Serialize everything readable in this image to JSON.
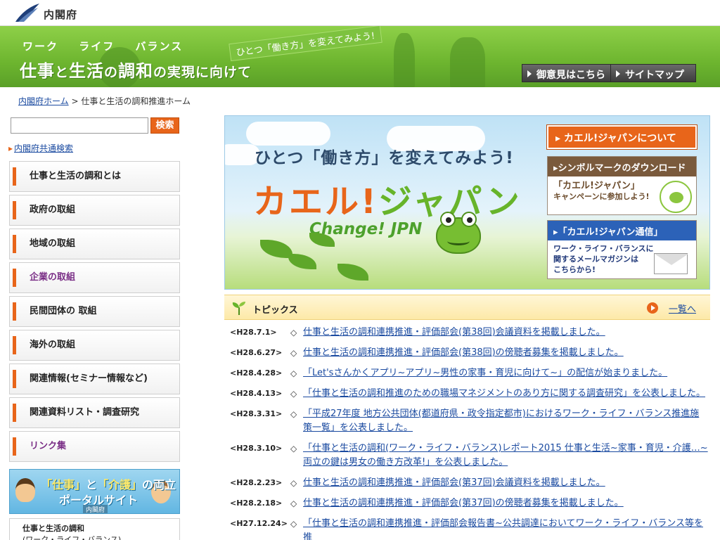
{
  "site": {
    "logo_text": "内閣府"
  },
  "banner": {
    "sub_words": [
      "ワーク",
      "ライフ",
      "バランス"
    ],
    "title_parts": [
      "仕事",
      "と",
      "生活",
      "の",
      "調和",
      "の実現に向けて"
    ],
    "slogan": "ひとつ「働き方」を変えてみよう!",
    "buttons": [
      "御意見はこちら",
      "サイトマップ"
    ]
  },
  "breadcrumb": {
    "home": "内閣府ホーム",
    "sep": ">",
    "current": "仕事と生活の調和推進ホーム"
  },
  "search": {
    "value": "",
    "button": "検索",
    "common_link": "内閣府共通検索"
  },
  "menu": [
    "仕事と生活の調和とは",
    "政府の取組",
    "地域の取組",
    "企業の取組",
    "民間団体の 取組",
    "海外の取組",
    "関連情報(セミナー情報など)",
    "関連資料リスト・調査研究",
    "リンク集"
  ],
  "side_banner1": {
    "line1_a": "「仕事」",
    "line1_b": "と",
    "line1_c": "「介護」",
    "line1_d": "の両立",
    "line2": "ポータルサイト",
    "org": "内閣府"
  },
  "side_banner2": {
    "line1": "仕事と生活の調和",
    "line2": "(ワーク・ライフ・バランス)"
  },
  "visual": {
    "title": "ひとつ「働き方」を変えてみよう!",
    "kaeru_1": "カエル!",
    "kaeru_2": "ジャパン",
    "change": "Change! JPN",
    "btn_about": "カエル!ジャパンについて",
    "btn_download": "シンボルマークのダウンロード",
    "download_l1": "「カエル!ジャパン」",
    "download_l2": "キャンペーンに参加しよう!",
    "btn_mail": "「カエル!ジャパン通信」",
    "mail_l1": "ワーク・ライフ・バランスに",
    "mail_l2": "関するメールマガジンは",
    "mail_l3": "こちらから!"
  },
  "topics": {
    "title": "トピックス",
    "more": "一覧へ",
    "items": [
      {
        "date": "<H28.7.1>",
        "text": "仕事と生活の調和連携推進・評価部会(第38回)会議資料を掲載しました。"
      },
      {
        "date": "<H28.6.27>",
        "text": "仕事と生活の調和連携推進・評価部会(第38回)の傍聴者募集を掲載しました。"
      },
      {
        "date": "<H28.4.28>",
        "text": "「Let'sさんかくアプリ~アプリ~男性の家事・育児に向けて~」の配信が始まりました。"
      },
      {
        "date": "<H28.4.13>",
        "text": "「仕事と生活の調和推進のための職場マネジメントのあり方に関する調査研究」を公表しました。"
      },
      {
        "date": "<H28.3.31>",
        "text": "「平成27年度 地方公共団体(都道府県・政令指定都市)におけるワーク・ライフ・バランス推進施策一覧」を公表しました。"
      },
      {
        "date": "<H28.3.10>",
        "text": "「仕事と生活の調和(ワーク・ライフ・バランス)レポート2015 仕事と生活~家事・育児・介護…~両立の鍵は男女の働き方改革!」を公表しました。"
      },
      {
        "date": "<H28.2.23>",
        "text": "仕事と生活の調和連携推進・評価部会(第37回)会議資料を掲載しました。"
      },
      {
        "date": "<H28.2.18>",
        "text": "仕事と生活の調和連携推進・評価部会(第37回)の傍聴者募集を掲載しました。"
      },
      {
        "date": "<H27.12.24>",
        "text": "「仕事と生活の調和連携推進・評価部会報告書~公共調達においてワーク・ライフ・バランス等を推"
      }
    ]
  }
}
